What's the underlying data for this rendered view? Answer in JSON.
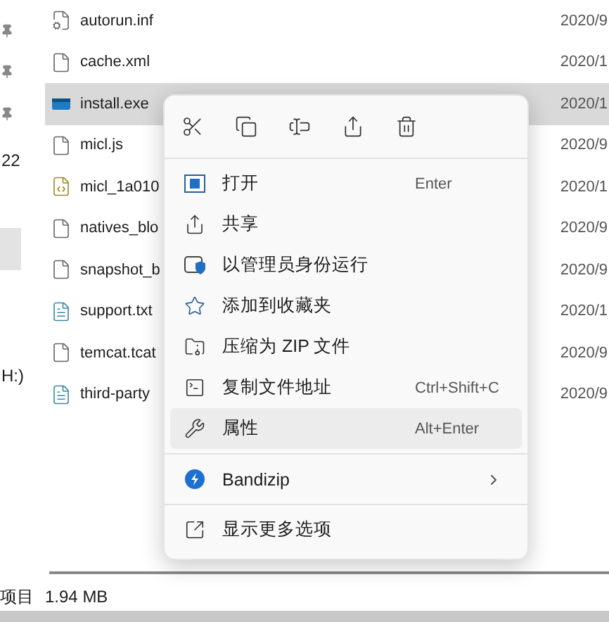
{
  "sidebar": {
    "items": [
      {
        "kind": "pin"
      },
      {
        "kind": "pin"
      },
      {
        "kind": "pin"
      },
      {
        "kind": "text",
        "label": "22"
      },
      {
        "kind": "entry",
        "selected": true
      },
      {
        "kind": "text",
        "label": "H:)"
      }
    ]
  },
  "files": [
    {
      "name": "autorun.inf",
      "date": "2020/9",
      "kind": "settings",
      "selected": false
    },
    {
      "name": "cache.xml",
      "date": "2020/1",
      "kind": "doc",
      "selected": false
    },
    {
      "name": "install.exe",
      "date": "2020/1",
      "kind": "app",
      "selected": true
    },
    {
      "name": "micl.js",
      "date": "2020/9",
      "kind": "doc",
      "selected": false
    },
    {
      "name": "micl_1a010",
      "date": "2020/1",
      "kind": "script",
      "selected": false
    },
    {
      "name": "natives_blo",
      "date": "2020/9",
      "kind": "doc",
      "selected": false
    },
    {
      "name": "snapshot_b",
      "date": "2020/9",
      "kind": "doc",
      "selected": false
    },
    {
      "name": "support.txt",
      "date": "2020/1",
      "kind": "text",
      "selected": false
    },
    {
      "name": "temcat.tcat",
      "date": "2020/9",
      "kind": "doc",
      "selected": false
    },
    {
      "name": "third-party",
      "date": "2020/9",
      "kind": "text",
      "selected": false
    }
  ],
  "context_menu": {
    "quick_actions": [
      {
        "kind": "cut"
      },
      {
        "kind": "copy"
      },
      {
        "kind": "rename"
      },
      {
        "kind": "share"
      },
      {
        "kind": "delete"
      }
    ],
    "groups": [
      {
        "items": [
          {
            "kind": "open",
            "label": "打开",
            "shortcut": "Enter",
            "hovered": false
          },
          {
            "kind": "share",
            "label": "共享",
            "hovered": false
          },
          {
            "kind": "admin",
            "label": "以管理员身份运行",
            "hovered": false
          },
          {
            "kind": "star",
            "label": "添加到收藏夹",
            "hovered": false
          },
          {
            "kind": "zip",
            "label": "压缩为 ZIP 文件",
            "hovered": false
          },
          {
            "kind": "path",
            "label": "复制文件地址",
            "shortcut": "Ctrl+Shift+C",
            "hovered": false
          },
          {
            "kind": "properties",
            "label": "属性",
            "shortcut": "Alt+Enter",
            "hovered": true
          }
        ]
      },
      {
        "items": [
          {
            "kind": "bandizip",
            "label": "Bandizip",
            "submenu": true,
            "hovered": false
          }
        ]
      },
      {
        "items": [
          {
            "kind": "more",
            "label": "显示更多选项",
            "hovered": false
          }
        ]
      }
    ]
  },
  "status_bar": {
    "items_text": "项目",
    "size": "1.94 MB"
  }
}
